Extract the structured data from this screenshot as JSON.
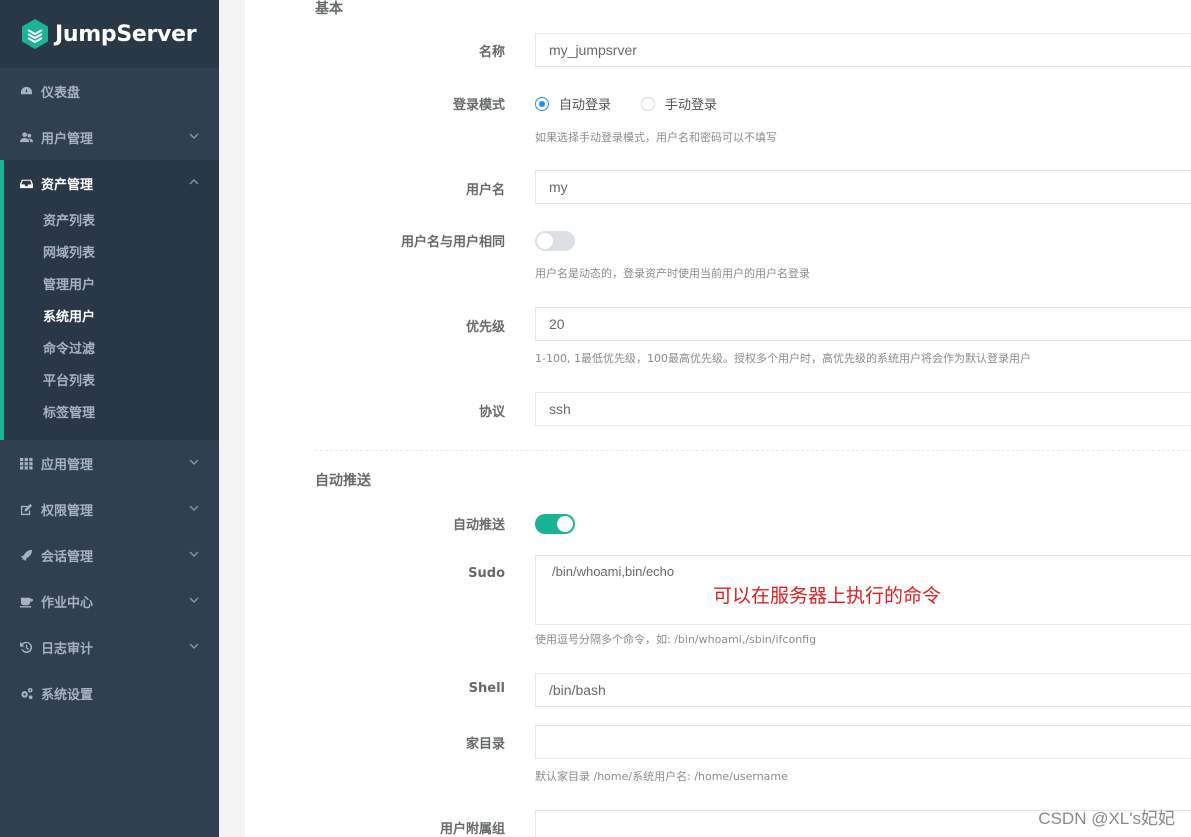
{
  "app": {
    "logo_text": "JumpServer"
  },
  "sidebar": {
    "items": [
      {
        "label": "仪表盘",
        "icon": "dashboard-icon"
      },
      {
        "label": "用户管理",
        "icon": "users-icon"
      },
      {
        "label": "资产管理",
        "icon": "inbox-icon",
        "active": true,
        "children": [
          {
            "label": "资产列表"
          },
          {
            "label": "网域列表"
          },
          {
            "label": "管理用户"
          },
          {
            "label": "系统用户",
            "active": true
          },
          {
            "label": "命令过滤"
          },
          {
            "label": "平台列表"
          },
          {
            "label": "标签管理"
          }
        ]
      },
      {
        "label": "应用管理",
        "icon": "grid-icon"
      },
      {
        "label": "权限管理",
        "icon": "edit-icon"
      },
      {
        "label": "会话管理",
        "icon": "rocket-icon"
      },
      {
        "label": "作业中心",
        "icon": "coffee-icon"
      },
      {
        "label": "日志审计",
        "icon": "history-icon"
      },
      {
        "label": "系统设置",
        "icon": "cogs-icon"
      }
    ]
  },
  "form": {
    "basic_title": "基本",
    "name": {
      "label": "名称",
      "value": "my_jumpsrver"
    },
    "login_mode": {
      "label": "登录模式",
      "options": [
        "自动登录",
        "手动登录"
      ],
      "selected": "自动登录",
      "hint": "如果选择手动登录模式，用户名和密码可以不填写"
    },
    "username": {
      "label": "用户名",
      "value": "my"
    },
    "username_same_as_user": {
      "label": "用户名与用户相同",
      "enabled": false,
      "hint": "用户名是动态的，登录资产时使用当前用户的用户名登录"
    },
    "priority": {
      "label": "优先级",
      "value": "20",
      "hint": "1-100, 1最低优先级，100最高优先级。授权多个用户时，高优先级的系统用户将会作为默认登录用户"
    },
    "protocol": {
      "label": "协议",
      "value": "ssh"
    },
    "auto_push_title": "自动推送",
    "auto_push": {
      "label": "自动推送",
      "enabled": true
    },
    "sudo": {
      "label": "Sudo",
      "value": "/bin/whoami,bin/echo",
      "hint": "使用逗号分隔多个命令，如: /bin/whoami,/sbin/ifconfig"
    },
    "shell": {
      "label": "Shell",
      "value": "/bin/bash"
    },
    "home": {
      "label": "家目录",
      "value": "",
      "hint": "默认家目录 /home/系统用户名: /home/username"
    },
    "groups": {
      "label": "用户附属组"
    }
  },
  "annotation": "可以在服务器上执行的命令",
  "watermark": "CSDN @XL's妃妃",
  "colors": {
    "sidebar_bg": "#2f4050",
    "accent": "#1ab394",
    "radio_blue": "#1890ff",
    "annotation_red": "#e02020"
  }
}
